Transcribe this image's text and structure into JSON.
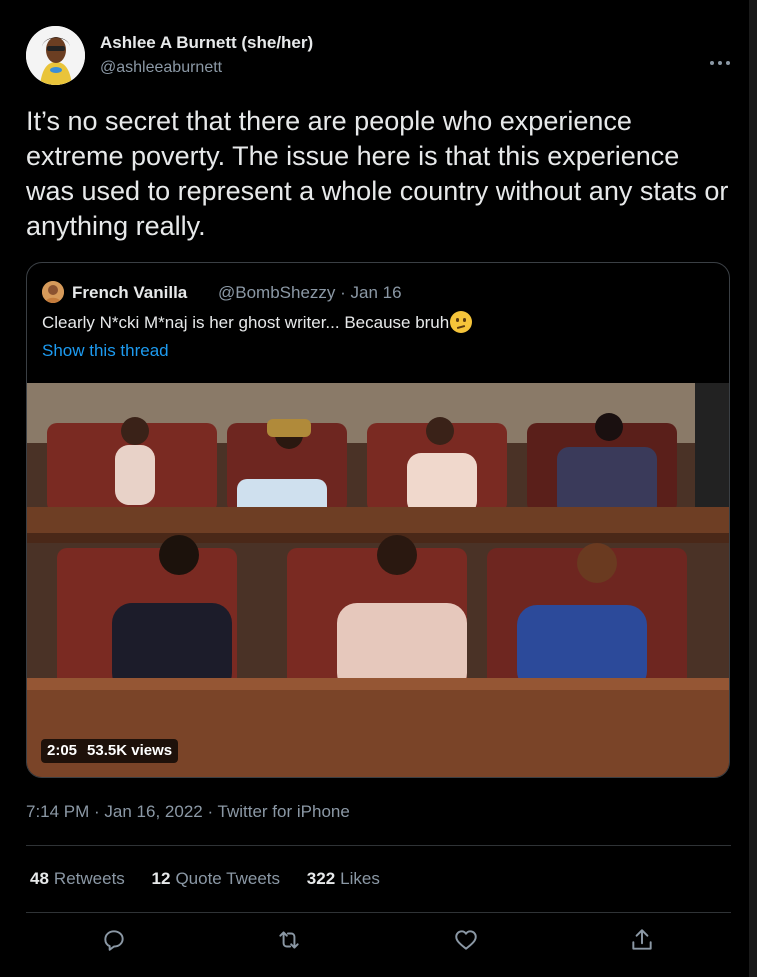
{
  "tweet": {
    "author_name": "Ashlee A Burnett (she/her)",
    "author_handle": "@ashleeaburnett",
    "more_icon": "more-horizontal-icon",
    "text": "It’s no secret that there are people who experience extreme poverty. The issue here is that this experience was used to represent a whole country without any stats or anything really.",
    "quoted": {
      "name": "French Vanilla",
      "handle": "@BombShezzy",
      "date": "Jan 16",
      "text": "Clearly N*cki M*naj is her ghost writer... Because bruh",
      "emoji_icon": "confused-face-emoji-icon",
      "show_thread": "Show this thread",
      "video": {
        "duration": "2:05",
        "views": "53.5K views"
      }
    },
    "timestamp": "7:14 PM · Jan 16, 2022 · Twitter for iPhone",
    "stats": {
      "retweets_count": "48",
      "retweets_label": "Retweets",
      "quotes_count": "12",
      "quotes_label": "Quote Tweets",
      "likes_count": "322",
      "likes_label": "Likes"
    },
    "actions": [
      "reply-icon",
      "retweet-icon",
      "like-icon",
      "share-icon"
    ]
  },
  "colors": {
    "background": "#000000",
    "link": "#1d9bf0",
    "secondary_text": "#8b98a5",
    "border": "#2f3336"
  }
}
